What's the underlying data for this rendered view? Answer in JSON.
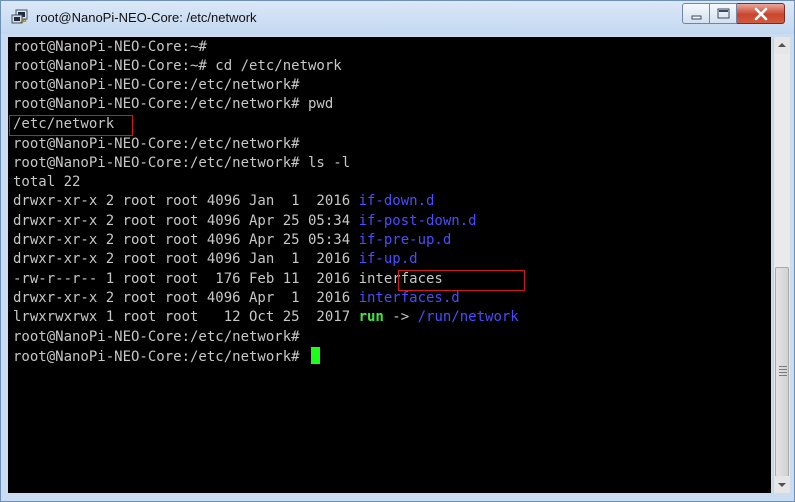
{
  "window": {
    "title": "root@NanoPi-NEO-Core: /etc/network",
    "icon": "putty-icon"
  },
  "terminal": {
    "lines": [
      "root@NanoPi-NEO-Core:~#",
      "root@NanoPi-NEO-Core:~# cd /etc/network",
      "root@NanoPi-NEO-Core:/etc/network#",
      "root@NanoPi-NEO-Core:/etc/network# pwd",
      "/etc/network",
      "root@NanoPi-NEO-Core:/etc/network#",
      "root@NanoPi-NEO-Core:/etc/network# ls -l",
      "total 22"
    ],
    "listing": [
      {
        "meta": "drwxr-xr-x 2 root root 4096 Jan  1  2016 ",
        "name": "if-down.d"
      },
      {
        "meta": "drwxr-xr-x 2 root root 4096 Apr 25 05:34 ",
        "name": "if-post-down.d"
      },
      {
        "meta": "drwxr-xr-x 2 root root 4096 Apr 25 05:34 ",
        "name": "if-pre-up.d"
      },
      {
        "meta": "drwxr-xr-x 2 root root 4096 Jan  1  2016 ",
        "name": "if-up.d"
      },
      {
        "meta": "-rw-r--r-- 1 root root  176 Feb 11  2016 ",
        "name": "interfaces"
      },
      {
        "meta": "drwxr-xr-x 2 root root 4096 Apr  1  2016 ",
        "name": "interfaces.d"
      }
    ],
    "symlink": {
      "meta": "lrwxrwxrwx 1 root root   12 Oct 25  2017 ",
      "name": "run",
      "arrow": " -> ",
      "target": "/run/network"
    },
    "tail_lines": [
      "root@NanoPi-NEO-Core:/etc/network#",
      "root@NanoPi-NEO-Core:/etc/network#"
    ]
  },
  "colors": {
    "terminal_bg": "#000000",
    "text": "#c7c7c7",
    "directory": "#4b4bff",
    "symlink": "#42e642",
    "cursor": "#1cff1c",
    "highlight": "#d11a1a"
  }
}
